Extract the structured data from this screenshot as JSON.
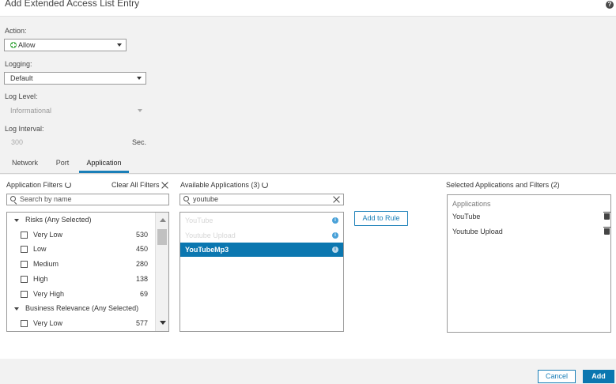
{
  "dialog": {
    "title": "Add Extended Access List Entry",
    "help_icon": "?"
  },
  "form": {
    "action": {
      "label": "Action:",
      "value": "Allow",
      "icon": "allow-plus-icon",
      "accent_color": "#4caf50"
    },
    "logging": {
      "label": "Logging:",
      "value": "Default"
    },
    "log_level": {
      "label": "Log Level:",
      "value": "Informational"
    },
    "log_interval": {
      "label": "Log Interval:",
      "value": "300",
      "unit": "Sec."
    }
  },
  "tabs": [
    {
      "label": "Network"
    },
    {
      "label": "Port"
    },
    {
      "label": "Application",
      "active": true
    }
  ],
  "filters_panel": {
    "title": "Application Filters",
    "clear_all": "Clear All Filters",
    "search_placeholder": "Search by name",
    "groups": [
      {
        "label": "Risks (Any Selected)",
        "items": [
          {
            "label": "Very Low",
            "count": "530"
          },
          {
            "label": "Low",
            "count": "450"
          },
          {
            "label": "Medium",
            "count": "280"
          },
          {
            "label": "High",
            "count": "138"
          },
          {
            "label": "Very High",
            "count": "69"
          }
        ]
      },
      {
        "label": "Business Relevance (Any Selected)",
        "items": [
          {
            "label": "Very Low",
            "count": "577"
          }
        ]
      }
    ]
  },
  "available_panel": {
    "title": "Available Applications (3)",
    "search_value": "youtube",
    "apps": [
      {
        "label": "YouTube",
        "state": "disabled"
      },
      {
        "label": "Youtube Upload",
        "state": "disabled"
      },
      {
        "label": "YouTubeMp3",
        "state": "selected"
      }
    ]
  },
  "add_to_rule": "Add to Rule",
  "selected_panel": {
    "title": "Selected Applications and Filters (2)",
    "header": "Applications",
    "items": [
      {
        "label": "YouTube"
      },
      {
        "label": "Youtube Upload"
      }
    ]
  },
  "footer": {
    "cancel": "Cancel",
    "add": "Add"
  },
  "colors": {
    "primary": "#0b77b0",
    "link": "#1a7fb8",
    "info": "#49a1d8"
  }
}
